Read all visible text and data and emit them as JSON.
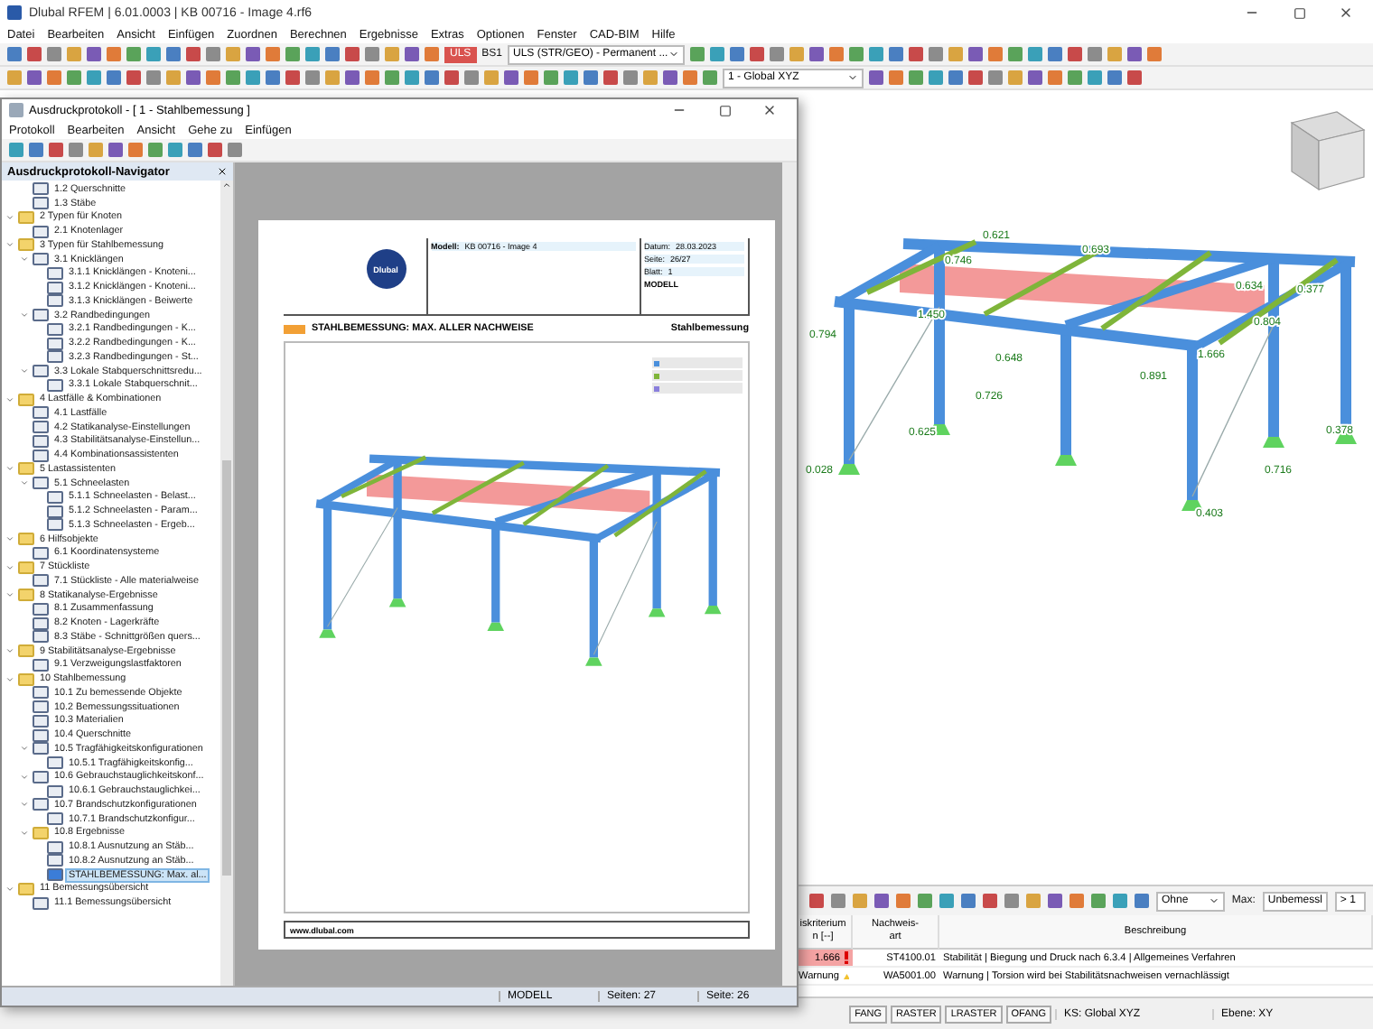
{
  "window": {
    "title": "Dlubal RFEM | 6.01.0003 | KB 00716 - Image 4.rf6"
  },
  "menu": [
    "Datei",
    "Bearbeiten",
    "Ansicht",
    "Einfügen",
    "Zuordnen",
    "Berechnen",
    "Ergebnisse",
    "Extras",
    "Optionen",
    "Fenster",
    "CAD-BIM",
    "Hilfe"
  ],
  "toolbar": {
    "load_type_badge": "ULS",
    "load_combo": "BS1",
    "combo_select": "ULS (STR/GEO) - Permanent ...",
    "coord_select": "1 - Global XYZ"
  },
  "view": {
    "values": [
      "0.621",
      "0.746",
      "0.693",
      "0.634",
      "0.377",
      "0.804",
      "1.450",
      "0.794",
      "0.648",
      "0.726",
      "0.891",
      "1.666",
      "0.625",
      "0.378",
      "0.716",
      "0.403",
      "0.028"
    ]
  },
  "dialog": {
    "title": "Ausdruckprotokoll - [ 1 - Stahlbemessung ]",
    "menu": [
      "Protokoll",
      "Bearbeiten",
      "Ansicht",
      "Gehe zu",
      "Einfügen"
    ],
    "navigator": {
      "title": "Ausdruckprotokoll-Navigator",
      "tree": [
        {
          "kind": "hidden",
          "children": [
            {
              "kind": "page",
              "label": "1.2 Querschnitte",
              "selected": false
            },
            {
              "kind": "page",
              "label": "1.3 Stäbe",
              "selected": false
            }
          ]
        },
        {
          "kind": "folder",
          "label": "2 Typen für Knoten",
          "expanded": true,
          "selected": false,
          "children": [
            {
              "kind": "page",
              "label": "2.1 Knotenlager",
              "selected": false
            }
          ]
        },
        {
          "kind": "folder",
          "label": "3 Typen für Stahlbemessung",
          "expanded": true,
          "selected": false,
          "children": [
            {
              "kind": "page",
              "label": "3.1 Knicklängen",
              "expanded": true,
              "selected": false,
              "children": [
                {
                  "kind": "page",
                  "label": "3.1.1 Knicklängen - Knoteni...",
                  "selected": false
                },
                {
                  "kind": "page",
                  "label": "3.1.2 Knicklängen - Knoteni...",
                  "selected": false
                },
                {
                  "kind": "page",
                  "label": "3.1.3 Knicklängen - Beiwerte",
                  "selected": false
                }
              ]
            },
            {
              "kind": "page",
              "label": "3.2 Randbedingungen",
              "expanded": true,
              "selected": false,
              "children": [
                {
                  "kind": "page",
                  "label": "3.2.1 Randbedingungen - K...",
                  "selected": false
                },
                {
                  "kind": "page",
                  "label": "3.2.2 Randbedingungen - K...",
                  "selected": false
                },
                {
                  "kind": "page",
                  "label": "3.2.3 Randbedingungen - St...",
                  "selected": false
                }
              ]
            },
            {
              "kind": "page",
              "label": "3.3 Lokale Stabquerschnittsredu...",
              "expanded": true,
              "selected": false,
              "children": [
                {
                  "kind": "page",
                  "label": "3.3.1 Lokale Stabquerschnit...",
                  "selected": false
                }
              ]
            }
          ]
        },
        {
          "kind": "folder",
          "label": "4 Lastfälle & Kombinationen",
          "expanded": true,
          "selected": false,
          "children": [
            {
              "kind": "page",
              "label": "4.1 Lastfälle",
              "selected": false
            },
            {
              "kind": "page",
              "label": "4.2 Statikanalyse-Einstellungen",
              "selected": false
            },
            {
              "kind": "page",
              "label": "4.3 Stabilitätsanalyse-Einstellun...",
              "selected": false
            },
            {
              "kind": "page",
              "label": "4.4 Kombinationsassistenten",
              "selected": false
            }
          ]
        },
        {
          "kind": "folder",
          "label": "5 Lastassistenten",
          "expanded": true,
          "selected": false,
          "children": [
            {
              "kind": "page",
              "label": "5.1 Schneelasten",
              "expanded": true,
              "selected": false,
              "children": [
                {
                  "kind": "page",
                  "label": "5.1.1 Schneelasten - Belast...",
                  "selected": false
                },
                {
                  "kind": "page",
                  "label": "5.1.2 Schneelasten - Param...",
                  "selected": false
                },
                {
                  "kind": "page",
                  "label": "5.1.3 Schneelasten - Ergeb...",
                  "selected": false
                }
              ]
            }
          ]
        },
        {
          "kind": "folder",
          "label": "6 Hilfsobjekte",
          "expanded": true,
          "selected": false,
          "children": [
            {
              "kind": "page",
              "label": "6.1 Koordinatensysteme",
              "selected": false
            }
          ]
        },
        {
          "kind": "folder",
          "label": "7 Stückliste",
          "expanded": true,
          "selected": false,
          "children": [
            {
              "kind": "page",
              "label": "7.1 Stückliste - Alle materialweise",
              "selected": false
            }
          ]
        },
        {
          "kind": "folder",
          "label": "8 Statikanalyse-Ergebnisse",
          "expanded": true,
          "selected": false,
          "children": [
            {
              "kind": "page",
              "label": "8.1 Zusammenfassung",
              "selected": false
            },
            {
              "kind": "page",
              "label": "8.2 Knoten - Lagerkräfte",
              "selected": false
            },
            {
              "kind": "page",
              "label": "8.3 Stäbe - Schnittgrößen quers...",
              "selected": false
            }
          ]
        },
        {
          "kind": "folder",
          "label": "9 Stabilitätsanalyse-Ergebnisse",
          "expanded": true,
          "selected": false,
          "children": [
            {
              "kind": "page",
              "label": "9.1 Verzweigungslastfaktoren",
              "selected": false
            }
          ]
        },
        {
          "kind": "folder",
          "label": "10 Stahlbemessung",
          "expanded": true,
          "selected": false,
          "children": [
            {
              "kind": "page",
              "label": "10.1 Zu bemessende Objekte",
              "selected": false
            },
            {
              "kind": "page",
              "label": "10.2 Bemessungssituationen",
              "selected": false
            },
            {
              "kind": "page",
              "label": "10.3 Materialien",
              "selected": false
            },
            {
              "kind": "page",
              "label": "10.4 Querschnitte",
              "selected": false
            },
            {
              "kind": "page",
              "label": "10.5 Tragfähigkeitskonfigurationen",
              "expanded": true,
              "selected": false,
              "children": [
                {
                  "kind": "page",
                  "label": "10.5.1 Tragfähigkeitskonfig...",
                  "selected": false
                }
              ]
            },
            {
              "kind": "page",
              "label": "10.6 Gebrauchstauglichkeitskonf...",
              "expanded": true,
              "selected": false,
              "children": [
                {
                  "kind": "page",
                  "label": "10.6.1 Gebrauchstauglichkei...",
                  "selected": false
                }
              ]
            },
            {
              "kind": "page",
              "label": "10.7 Brandschutzkonfigurationen",
              "expanded": true,
              "selected": false,
              "children": [
                {
                  "kind": "page",
                  "label": "10.7.1 Brandschutzkonfigur...",
                  "selected": false
                }
              ]
            },
            {
              "kind": "folder",
              "label": "10.8 Ergebnisse",
              "expanded": true,
              "selected": false,
              "children": [
                {
                  "kind": "page",
                  "label": "10.8.1 Ausnutzung an Stäb...",
                  "selected": false
                },
                {
                  "kind": "page",
                  "label": "10.8.2 Ausnutzung an Stäb...",
                  "selected": false
                },
                {
                  "kind": "graphic",
                  "label": "STAHLBEMESSUNG: Max. al...",
                  "selected": true
                }
              ]
            }
          ]
        },
        {
          "kind": "folder",
          "label": "11 Bemessungsübersicht",
          "expanded": true,
          "selected": false,
          "children": [
            {
              "kind": "page",
              "label": "11.1 Bemessungsübersicht",
              "selected": false
            }
          ]
        }
      ]
    },
    "page": {
      "model_label": "Modell:",
      "model": "KB 00716 - Image 4",
      "date_label": "Datum:",
      "date": "28.03.2023",
      "page_label": "Seite:",
      "page": "26/27",
      "sheet_label": "Blatt:",
      "sheet": "1",
      "section": "MODELL",
      "logo": "Dlubal",
      "title": "STAHLBEMESSUNG: MAX. ALLER NACHWEISE",
      "chapter": "Stahlbemessung",
      "footer": "www.dlubal.com"
    },
    "status": [
      "MODELL",
      "Seiten: 27",
      "Seite: 26"
    ]
  },
  "results": {
    "filter_select": "Ohne",
    "max_label": "Max:",
    "max_value": "Unbemessl",
    "threshold": "> 1",
    "columns": [
      {
        "lines": [
          "iskriterium",
          "n [--]"
        ]
      },
      {
        "lines": [
          "Nachweis-",
          "art"
        ]
      },
      {
        "lines": [
          "Beschreibung"
        ]
      }
    ],
    "rows": [
      {
        "kind": "error",
        "criterion": "1.666",
        "type": "ST4100.01",
        "description": "Stabilität | Biegung und Druck nach 6.3.4 | Allgemeines Verfahren"
      },
      {
        "kind": "warning",
        "criterion": "Warnung",
        "type": "WA5001.00",
        "description": "Warnung | Torsion wird bei Stabilitätsnachweisen vernachlässigt"
      }
    ]
  },
  "status_bar": {
    "toggles": [
      "FANG",
      "RASTER",
      "LRASTER",
      "OFANG"
    ],
    "coord_system": "KS: Global XYZ",
    "plane": "Ebene: XY"
  }
}
